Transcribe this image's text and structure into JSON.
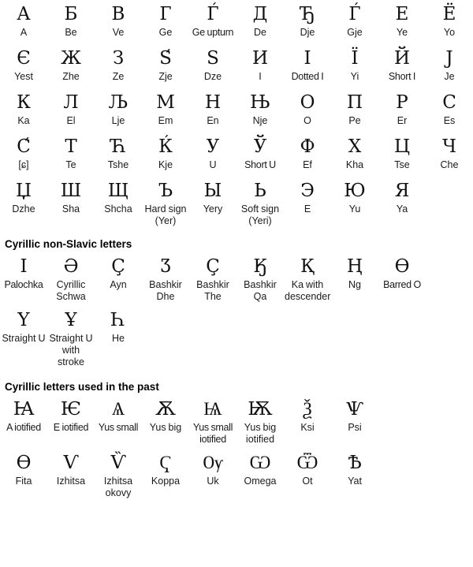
{
  "sections": [
    {
      "id": "main-alphabet",
      "heading": null,
      "rows": [
        [
          {
            "glyph": "А",
            "name": "A"
          },
          {
            "glyph": "Б",
            "name": "Be"
          },
          {
            "glyph": "В",
            "name": "Ve"
          },
          {
            "glyph": "Г",
            "name": "Ge"
          },
          {
            "glyph": "Ѓ",
            "name": "Ge upturn"
          },
          {
            "glyph": "Д",
            "name": "De"
          },
          {
            "glyph": "Ђ",
            "name": "Dje"
          },
          {
            "glyph": "Ѓ",
            "name": "Gje"
          },
          {
            "glyph": "Е",
            "name": "Ye"
          },
          {
            "glyph": "Ё",
            "name": "Yo"
          }
        ],
        [
          {
            "glyph": "Є",
            "name": "Yest"
          },
          {
            "glyph": "Ж",
            "name": "Zhe"
          },
          {
            "glyph": "З",
            "name": "Ze"
          },
          {
            "glyph": "Ѕ́",
            "name": "Zje"
          },
          {
            "glyph": "Ѕ",
            "name": "Dze"
          },
          {
            "glyph": "И",
            "name": "I"
          },
          {
            "glyph": "І",
            "name": "Dotted I"
          },
          {
            "glyph": "Ї",
            "name": "Yi"
          },
          {
            "glyph": "Й",
            "name": "Short I"
          },
          {
            "glyph": "Ј",
            "name": "Je"
          }
        ],
        [
          {
            "glyph": "К",
            "name": "Ka"
          },
          {
            "glyph": "Л",
            "name": "El"
          },
          {
            "glyph": "Љ",
            "name": "Lje"
          },
          {
            "glyph": "М",
            "name": "Em"
          },
          {
            "glyph": "Н",
            "name": "En"
          },
          {
            "glyph": "Њ",
            "name": "Nje"
          },
          {
            "glyph": "О",
            "name": "O"
          },
          {
            "glyph": "П",
            "name": "Pe"
          },
          {
            "glyph": "Р",
            "name": "Er"
          },
          {
            "glyph": "С",
            "name": "Es"
          }
        ],
        [
          {
            "glyph": "С́",
            "name": "[ɕ]"
          },
          {
            "glyph": "Т",
            "name": "Te"
          },
          {
            "glyph": "Ћ",
            "name": "Tshe"
          },
          {
            "glyph": "Ќ",
            "name": "Kje"
          },
          {
            "glyph": "У",
            "name": "U"
          },
          {
            "glyph": "Ў",
            "name": "Short U"
          },
          {
            "glyph": "Ф",
            "name": "Ef"
          },
          {
            "glyph": "Х",
            "name": "Kha"
          },
          {
            "glyph": "Ц",
            "name": "Tse"
          },
          {
            "glyph": "Ч",
            "name": "Che"
          }
        ],
        [
          {
            "glyph": "Џ",
            "name": "Dzhe"
          },
          {
            "glyph": "Ш",
            "name": "Sha"
          },
          {
            "glyph": "Щ",
            "name": "Shcha"
          },
          {
            "glyph": "Ъ",
            "name": "Hard sign (Yer)"
          },
          {
            "glyph": "Ы",
            "name": "Yery"
          },
          {
            "glyph": "Ь",
            "name": "Soft sign (Yeri)"
          },
          {
            "glyph": "Э",
            "name": "E"
          },
          {
            "glyph": "Ю",
            "name": "Yu"
          },
          {
            "glyph": "Я",
            "name": "Ya"
          },
          {
            "glyph": "",
            "name": ""
          }
        ]
      ]
    },
    {
      "id": "non-slavic",
      "heading": "Cyrillic non-Slavic letters",
      "rows": [
        [
          {
            "glyph": "Ӏ",
            "name": "Palochka"
          },
          {
            "glyph": "Ә",
            "name": "Cyrillic Schwa"
          },
          {
            "glyph": "Ҫ",
            "name": "Ayn"
          },
          {
            "glyph": "Ӡ",
            "name": "Bashkir Dhe"
          },
          {
            "glyph": "Ҫ",
            "name": "Bashkir The"
          },
          {
            "glyph": "Ӄ",
            "name": "Bashkir Qa"
          },
          {
            "glyph": "Қ",
            "name": "Ka with descender"
          },
          {
            "glyph": "Ң",
            "name": "Ng"
          },
          {
            "glyph": "Ө",
            "name": "Barred O"
          },
          {
            "glyph": "",
            "name": ""
          }
        ],
        [
          {
            "glyph": "Ү",
            "name": "Straight U"
          },
          {
            "glyph": "Ұ",
            "name": "Straight U with stroke"
          },
          {
            "glyph": "Һ",
            "name": "He"
          },
          {
            "glyph": "",
            "name": ""
          },
          {
            "glyph": "",
            "name": ""
          },
          {
            "glyph": "",
            "name": ""
          },
          {
            "glyph": "",
            "name": ""
          },
          {
            "glyph": "",
            "name": ""
          },
          {
            "glyph": "",
            "name": ""
          },
          {
            "glyph": "",
            "name": ""
          }
        ]
      ]
    },
    {
      "id": "historic",
      "heading": "Cyrillic letters used in the past",
      "rows": [
        [
          {
            "glyph": "Ꙗ",
            "name": "A iotified"
          },
          {
            "glyph": "Ѥ",
            "name": "E iotified"
          },
          {
            "glyph": "Ѧ",
            "name": "Yus small"
          },
          {
            "glyph": "Ѫ",
            "name": "Yus big"
          },
          {
            "glyph": "Ѩ",
            "name": "Yus small iotified"
          },
          {
            "glyph": "Ѭ",
            "name": "Yus big iotified"
          },
          {
            "glyph": "Ѯ",
            "name": "Ksi"
          },
          {
            "glyph": "Ѱ",
            "name": "Psi"
          },
          {
            "glyph": "",
            "name": ""
          },
          {
            "glyph": "",
            "name": ""
          }
        ],
        [
          {
            "glyph": "Ѳ",
            "name": "Fita"
          },
          {
            "glyph": "Ѵ",
            "name": "Izhitsa"
          },
          {
            "glyph": "Ѷ",
            "name": "Izhitsa okovy"
          },
          {
            "glyph": "Ҁ",
            "name": "Koppa"
          },
          {
            "glyph": "Ѹ",
            "name": "Uk"
          },
          {
            "glyph": "Ѡ",
            "name": "Omega"
          },
          {
            "glyph": "Ѿ",
            "name": "Ot"
          },
          {
            "glyph": "Ѣ",
            "name": "Yat"
          },
          {
            "glyph": "",
            "name": ""
          },
          {
            "glyph": "",
            "name": ""
          }
        ]
      ]
    }
  ]
}
